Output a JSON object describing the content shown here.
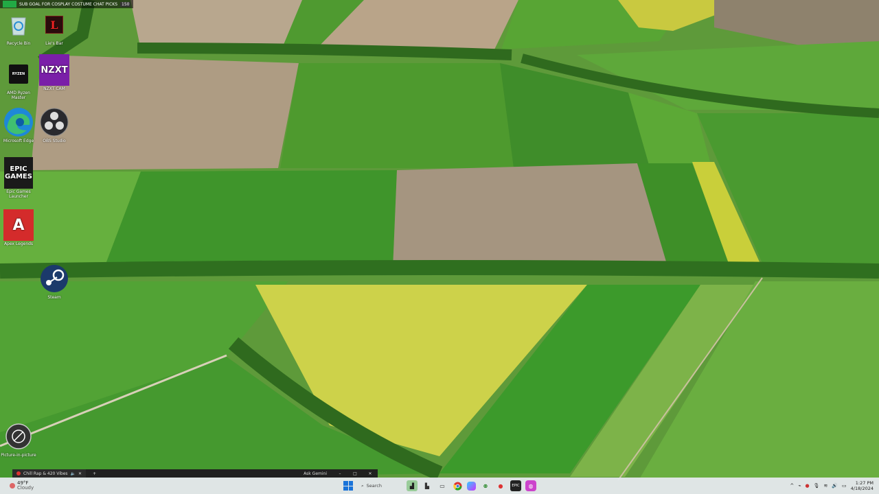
{
  "overlay": {
    "text": "SUB GOAL FOR COSPLAY COSTUME CHAT PICKS",
    "count": "150"
  },
  "desktop_icons": [
    {
      "label": "Recycle Bin",
      "icon": "recycle-bin-icon"
    },
    {
      "label": "Lie's Bar",
      "icon": "lies-bar-icon",
      "glyph": "L"
    },
    {
      "label": "AMD Ryzen Master",
      "icon": "amd-ryzen-master-icon",
      "glyph": "RYZEN"
    },
    {
      "label": "NZXT CAM",
      "icon": "nzxt-cam-icon",
      "glyph": "NZXT"
    },
    {
      "label": "Microsoft Edge",
      "icon": "edge-icon"
    },
    {
      "label": "OBS Studio",
      "icon": "obs-studio-icon"
    },
    {
      "label": "Epic Games Launcher",
      "icon": "epic-games-icon",
      "glyph": "EPIC\nGAMES"
    },
    {
      "label": "Apex Legends",
      "icon": "apex-legends-icon",
      "glyph": "A"
    },
    {
      "label": "Steam",
      "icon": "steam-icon"
    },
    {
      "label": "Picture-in-picture",
      "icon": "picture-in-picture-icon"
    }
  ],
  "mini_bar": {
    "tab_label": "Chill Rap & 420 Vibes",
    "new_tab": "+",
    "ask_gemini": "Ask Gemini",
    "minimize": "–",
    "maximize": "□",
    "close": "✕"
  },
  "taskbar": {
    "weather_temp": "49°F",
    "weather_desc": "Cloudy",
    "search_placeholder": "Search",
    "apps": [
      "file-explorer-icon",
      "chrome-icon",
      "copilot-icon",
      "xbox-icon",
      "discord-icon",
      "epic-games-taskbar-icon",
      "media-icon"
    ],
    "time": "1:27 PM",
    "date": "4/18/2024"
  },
  "colors": {
    "taskbar": "#e4e8ec",
    "accent": "#1a73d9"
  }
}
